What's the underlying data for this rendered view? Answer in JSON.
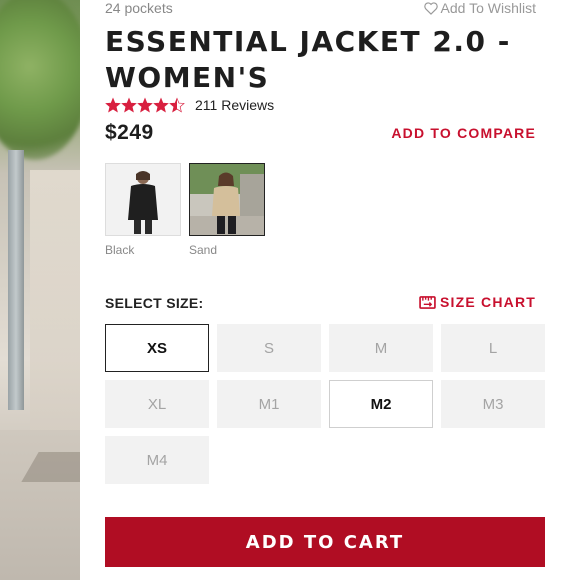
{
  "product": {
    "pockets_text": "24 pockets",
    "wishlist_label": "Add To Wishlist",
    "title": "ESSENTIAL JACKET 2.0 - WOMEN'S",
    "rating_value": 4.5,
    "rating_max": 5,
    "reviews_label": "211 Reviews",
    "price": "$249",
    "compare_label": "ADD TO COMPARE"
  },
  "colors": {
    "accent_red": "#c8102e",
    "cart_red": "#b00d23",
    "star_red": "#d81f3f"
  },
  "swatches": [
    {
      "label": "Black",
      "selected": false
    },
    {
      "label": "Sand",
      "selected": true
    }
  ],
  "size_selector": {
    "heading": "SELECT SIZE:",
    "chart_label": "SIZE CHART",
    "options": [
      {
        "label": "XS",
        "state": "selected"
      },
      {
        "label": "S",
        "state": "unavailable"
      },
      {
        "label": "M",
        "state": "unavailable"
      },
      {
        "label": "L",
        "state": "unavailable"
      },
      {
        "label": "XL",
        "state": "unavailable"
      },
      {
        "label": "M1",
        "state": "unavailable"
      },
      {
        "label": "M2",
        "state": "available"
      },
      {
        "label": "M3",
        "state": "unavailable"
      },
      {
        "label": "M4",
        "state": "unavailable"
      }
    ]
  },
  "cart": {
    "button_label": "ADD TO CART"
  },
  "icons": {
    "wishlist": "heart-outline-icon",
    "star": "star-icon",
    "size_chart": "ruler-icon"
  }
}
